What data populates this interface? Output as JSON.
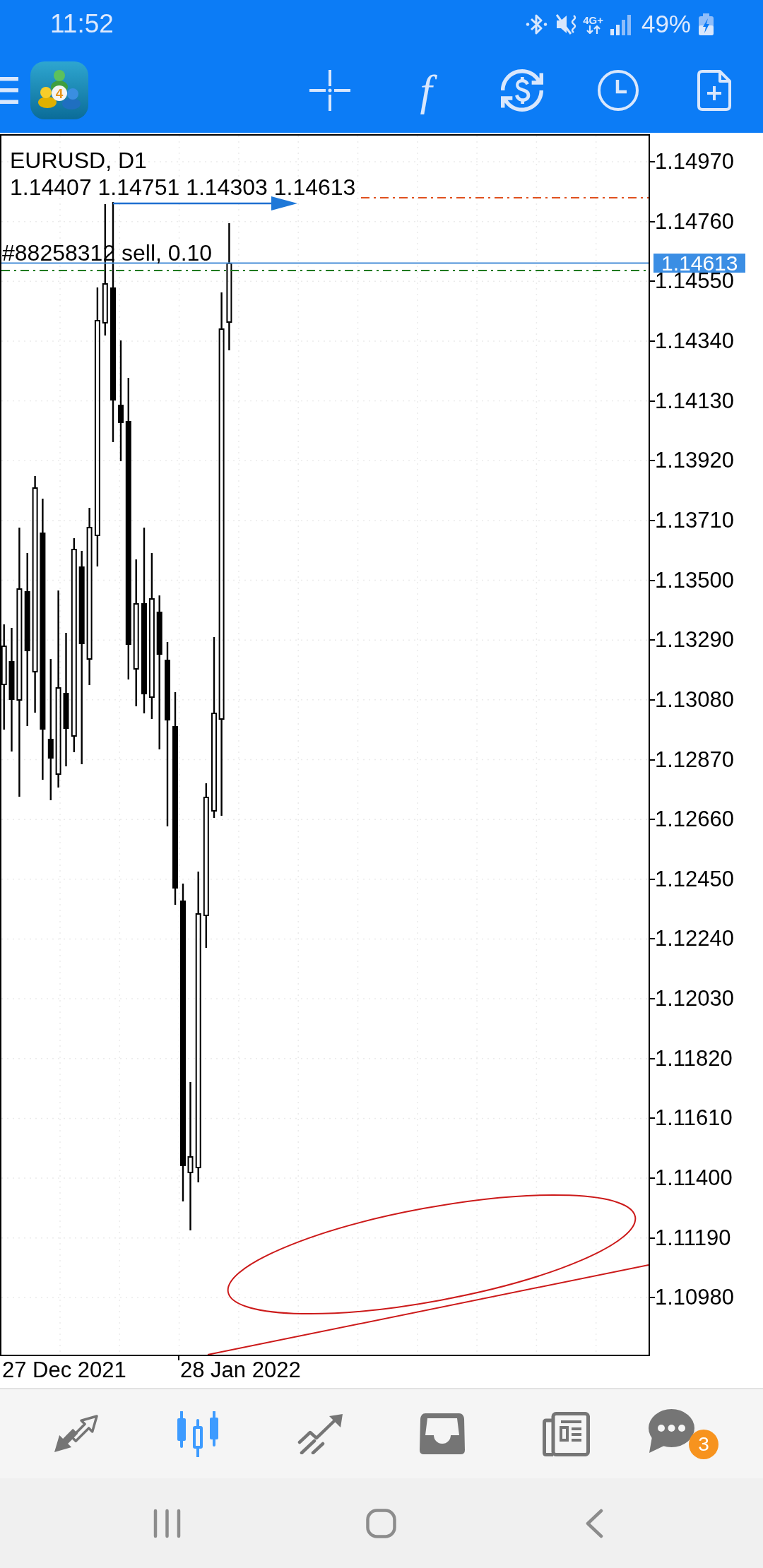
{
  "status_bar": {
    "time": "11:52",
    "network": "4G+",
    "battery": "49%"
  },
  "toolbar": {
    "logo_badge": "4",
    "indicator_symbol": "f"
  },
  "chart": {
    "symbol": "EURUSD, D1",
    "ohlc": "1.14407 1.14751 1.14303 1.14613",
    "order_label": "#88258312 sell, 0.10"
  },
  "price_axis": {
    "labels": [
      "1.14970",
      "1.14760",
      "1.14550",
      "1.14340",
      "1.14130",
      "1.13920",
      "1.13710",
      "1.13500",
      "1.13290",
      "1.13080",
      "1.12870",
      "1.12660",
      "1.12450",
      "1.12240",
      "1.12030",
      "1.11820",
      "1.11610",
      "1.11400",
      "1.11190",
      "1.10980"
    ],
    "current_price": "1.14613"
  },
  "time_axis": {
    "labels": [
      "27 Dec 2021",
      "28 Jan 2022"
    ]
  },
  "bottom_nav": [
    {
      "selected": false
    },
    {
      "selected": true
    },
    {
      "selected": false
    },
    {
      "selected": false
    },
    {
      "selected": false
    },
    {
      "selected": false,
      "badge": "3"
    }
  ]
}
